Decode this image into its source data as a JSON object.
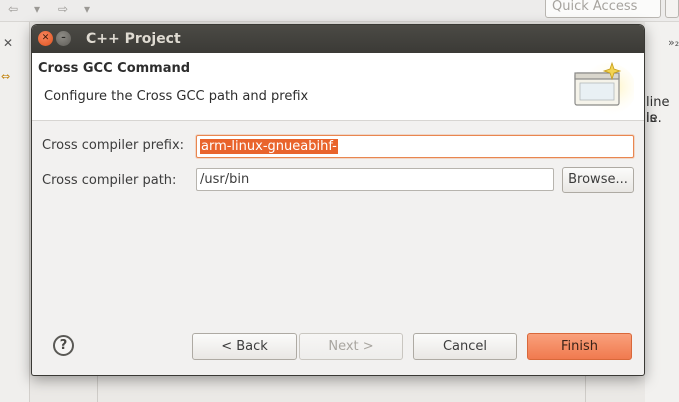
{
  "background": {
    "quick_access_placeholder": "Quick Access",
    "right_text_line1": "line is",
    "right_text_line2": "le.",
    "left_close": "✕",
    "right_chevron": "»₂"
  },
  "dialog": {
    "window_title": "C++ Project",
    "page_title": "Cross GCC Command",
    "page_description": "Configure the Cross GCC path and prefix",
    "fields": {
      "prefix_label": "Cross compiler prefix:",
      "prefix_value": "arm-linux-gnueabihf-",
      "path_label": "Cross compiler path:",
      "path_value": "/usr/bin",
      "browse_label": "Browse..."
    },
    "buttons": {
      "help": "?",
      "back": "< Back",
      "next": "Next >",
      "cancel": "Cancel",
      "finish": "Finish"
    }
  },
  "colors": {
    "accent": "#f07a4f",
    "selection": "#e9642c",
    "titlebar": "#3b3a36"
  }
}
